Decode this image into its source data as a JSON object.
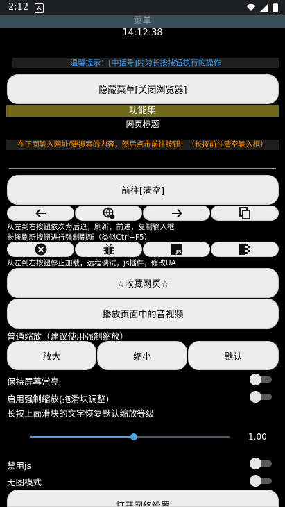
{
  "status_bar": {
    "time": "2:12",
    "notification_letter": "A"
  },
  "header": {
    "title": "菜单",
    "clock": "14:12:38"
  },
  "notice": "温馨提示：[中括号]内为长按按钮执行的操作",
  "hide_menu_button": "隐藏菜单[关闭浏览器]",
  "section_title": "功能集",
  "page_title": "网页标题",
  "url_hint": "在下面输入网址/要搜索的内容，然后点击前往按钮！（长按前往清空输入框）",
  "go_button": "前往[清空]",
  "nav_desc_1": "从左到右按钮依次为后退，刷新，前进，复制输入框",
  "nav_desc_2": "长按刷新按钮进行强制刷新（类似Ctrl+F5）",
  "tools_desc": "从左到右按钮停止加载，远程调试，js插件，修改UA",
  "tool_icons": {
    "js_label": "JS"
  },
  "bookmark_button": "☆收藏网页☆",
  "play_media_button": "播放页面中的音视频",
  "zoom_label": "普通缩放（建议使用强制缩放）",
  "zoom_buttons": {
    "zoom_in": "放大",
    "zoom_out": "缩小",
    "default": "默认"
  },
  "toggles": {
    "keep_screen_on": {
      "label": "保持屏幕常亮",
      "on": false
    },
    "force_zoom": {
      "label": "启用强制缩放(拖滑块调整)",
      "on": false
    },
    "disable_js": {
      "label": "禁用js",
      "on": false
    },
    "no_image": {
      "label": "无图模式",
      "on": false
    }
  },
  "slider_hint": "长按上面滑块的文字恢复默认缩放等级",
  "zoom_slider": {
    "value_label": "1.00",
    "fraction": 0.52
  },
  "network_button": "打开网络设置",
  "colors": {
    "section_bg": "#6f6a1a",
    "notice_blue": "#3aa0ff",
    "hint_orange": "#ff8c00",
    "slider_accent": "#4aa8e0"
  }
}
